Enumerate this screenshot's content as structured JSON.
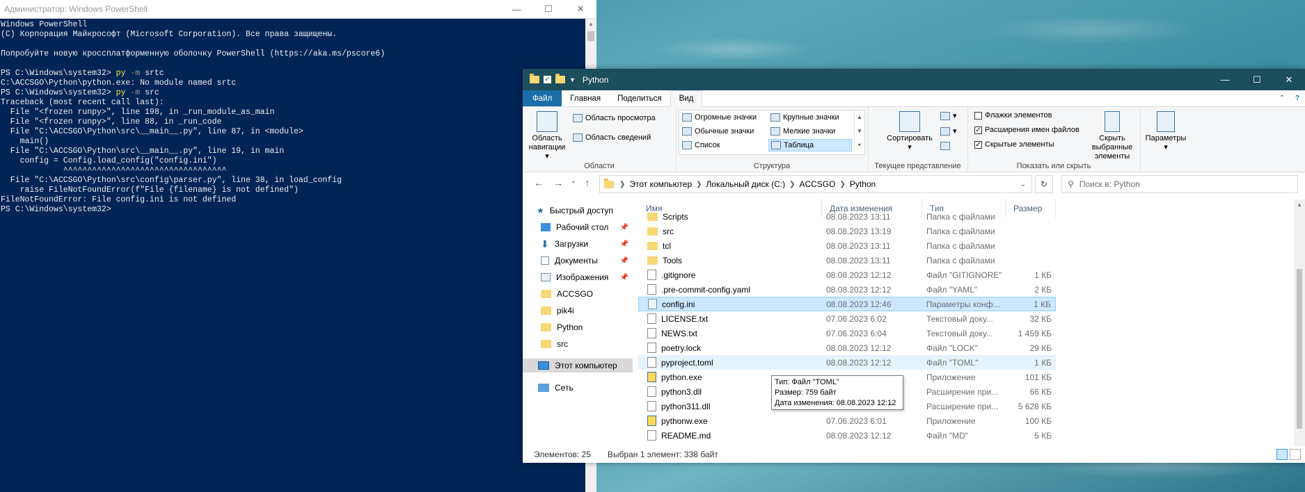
{
  "powershell": {
    "title": "Администратор: Windows PowerShell",
    "lines": [
      {
        "text": "Windows PowerShell"
      },
      {
        "text": "(C) Корпорация Майкрософт (Microsoft Corporation). Все права защищены."
      },
      {
        "text": ""
      },
      {
        "text": "Попробуйте новую кроссплатформенную оболочку PowerShell (https://aka.ms/pscore6)"
      },
      {
        "text": ""
      },
      {
        "prompt": "PS C:\\Windows\\system32> ",
        "cmd": "py",
        "flag": " -m",
        "arg": " srtc"
      },
      {
        "text": "C:\\ACCSGO\\Python\\python.exe: No module named srtc"
      },
      {
        "prompt": "PS C:\\Windows\\system32> ",
        "cmd": "py",
        "flag": " -m",
        "arg": " src"
      },
      {
        "text": "Traceback (most recent call last):"
      },
      {
        "text": "  File \"<frozen runpy>\", line 198, in _run_module_as_main"
      },
      {
        "text": "  File \"<frozen runpy>\", line 88, in _run_code"
      },
      {
        "text": "  File \"C:\\ACCSGO\\Python\\src\\__main__.py\", line 87, in <module>"
      },
      {
        "text": "    main()"
      },
      {
        "text": "  File \"C:\\ACCSGO\\Python\\src\\__main__.py\", line 19, in main"
      },
      {
        "text": "    config = Config.load_config(\"config.ini\")"
      },
      {
        "text": "             ^^^^^^^^^^^^^^^^^^^^^^^^^^^^^^^^^^"
      },
      {
        "text": "  File \"C:\\ACCSGO\\Python\\src\\config\\parser.py\", line 38, in load_config"
      },
      {
        "text": "    raise FileNotFoundError(f\"File {filename} is not defined\")"
      },
      {
        "text": "FileNotFoundError: File config.ini is not defined"
      },
      {
        "text": "PS C:\\Windows\\system32>"
      }
    ]
  },
  "explorer": {
    "title": "Python",
    "tabs": [
      "Файл",
      "Главная",
      "Поделиться",
      "Вид"
    ],
    "ribbon": {
      "areas": {
        "label": "Области",
        "nav_pane": "Область навигации",
        "preview": "Область просмотра",
        "details": "Область сведений"
      },
      "layout": {
        "label": "Структура",
        "huge": "Огромные значки",
        "large": "Крупные значки",
        "normal": "Обычные значки",
        "small": "Мелкие значки",
        "list": "Список",
        "table": "Таблица"
      },
      "current_view": {
        "label": "Текущее представление",
        "sort": "Сортировать"
      },
      "show_hide": {
        "label": "Показать или скрыть",
        "checkboxes": "Флажки элементов",
        "extensions": "Расширения имен файлов",
        "hidden": "Скрытые элементы",
        "hide_selected": "Скрыть выбранные элементы"
      },
      "options": "Параметры"
    },
    "breadcrumbs": [
      "Этот компьютер",
      "Локальный диск (C:)",
      "ACCSGO",
      "Python"
    ],
    "search_placeholder": "Поиск в: Python",
    "nav": {
      "quick_access": "Быстрый доступ",
      "pinned": [
        "Рабочий стол",
        "Загрузки",
        "Документы",
        "Изображения"
      ],
      "folders": [
        "ACCSGO",
        "pik4i",
        "Python",
        "src"
      ],
      "this_pc": "Этот компьютер",
      "network": "Сеть"
    },
    "columns": [
      "Имя",
      "Дата изменения",
      "Тип",
      "Размер"
    ],
    "files": [
      {
        "name": "Scripts",
        "date": "08.08.2023 13:11",
        "type": "Папка с файлами",
        "size": "",
        "kind": "folder"
      },
      {
        "name": "src",
        "date": "08.08.2023 13:19",
        "type": "Папка с файлами",
        "size": "",
        "kind": "folder"
      },
      {
        "name": "tcl",
        "date": "08.08.2023 13:11",
        "type": "Папка с файлами",
        "size": "",
        "kind": "folder"
      },
      {
        "name": "Tools",
        "date": "08.08.2023 13:11",
        "type": "Папка с файлами",
        "size": "",
        "kind": "folder"
      },
      {
        "name": ".gitignore",
        "date": "08.08.2023 12:12",
        "type": "Файл \"GITIGNORE\"",
        "size": "1 КБ",
        "kind": "file"
      },
      {
        "name": ".pre-commit-config.yaml",
        "date": "08.08.2023 12:12",
        "type": "Файл \"YAML\"",
        "size": "2 КБ",
        "kind": "file"
      },
      {
        "name": "config.ini",
        "date": "08.08.2023 12:46",
        "type": "Параметры конф...",
        "size": "1 КБ",
        "kind": "cfg"
      },
      {
        "name": "LICENSE.txt",
        "date": "07.06.2023 6:02",
        "type": "Текстовый доку...",
        "size": "32 КБ",
        "kind": "file"
      },
      {
        "name": "NEWS.txt",
        "date": "07.06.2023 6:04",
        "type": "Текстовый доку...",
        "size": "1 459 КБ",
        "kind": "file"
      },
      {
        "name": "poetry.lock",
        "date": "08.08.2023 12:12",
        "type": "Файл \"LOCK\"",
        "size": "29 КБ",
        "kind": "file"
      },
      {
        "name": "pyproject.toml",
        "date": "08.08.2023 12:12",
        "type": "Файл \"TOML\"",
        "size": "1 КБ",
        "kind": "file"
      },
      {
        "name": "python.exe",
        "date": "",
        "type": "Приложение",
        "size": "101 КБ",
        "kind": "exe"
      },
      {
        "name": "python3.dll",
        "date": "",
        "type": "Расширение при...",
        "size": "66 КБ",
        "kind": "file"
      },
      {
        "name": "python311.dll",
        "date": "",
        "type": "Расширение при...",
        "size": "5 628 КБ",
        "kind": "file"
      },
      {
        "name": "pythonw.exe",
        "date": "07.06.2023 6:01",
        "type": "Приложение",
        "size": "100 КБ",
        "kind": "exe"
      },
      {
        "name": "README.md",
        "date": "08.08.2023 12:12",
        "type": "Файл \"MD\"",
        "size": "5 КБ",
        "kind": "file"
      }
    ],
    "selected_index": 6,
    "hover_index": 10,
    "tooltip": [
      "Тип: Файл \"TOML\"",
      "Размер: 759 байт",
      "Дата изменения: 08.08.2023 12:12"
    ],
    "status": {
      "count": "Элементов: 25",
      "selected": "Выбран 1 элемент: 338 байт"
    }
  }
}
